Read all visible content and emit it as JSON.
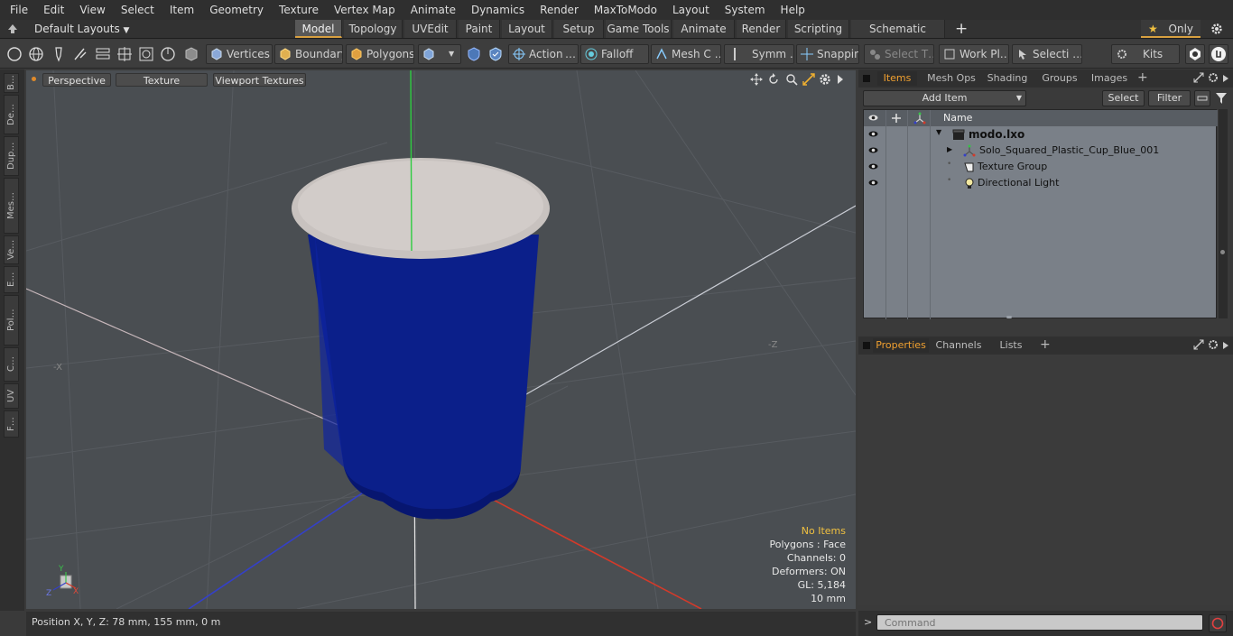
{
  "menubar": {
    "items": [
      "File",
      "Edit",
      "View",
      "Select",
      "Item",
      "Geometry",
      "Texture",
      "Vertex Map",
      "Animate",
      "Dynamics",
      "Render",
      "MaxToModo",
      "Layout",
      "System",
      "Help"
    ]
  },
  "layoutbar": {
    "layout_name": "Default Layouts",
    "tabs": [
      "Model",
      "Topology",
      "UVEdit",
      "Paint",
      "Layout",
      "Setup",
      "Game Tools",
      "Animate",
      "Render",
      "Scripting",
      "Schematic Fusion"
    ],
    "active_tab": "Model",
    "only_label": "Only"
  },
  "toolbar": {
    "vertices": "Vertices",
    "boundary": "Boundary",
    "polygons": "Polygons",
    "action": "Action",
    "action_more": "…",
    "falloff": "Falloff",
    "mesh": "Mesh C …",
    "symm": "Symm …",
    "snapping": "Snapping",
    "select_t": "Select T…",
    "work_pl": "Work Pl…",
    "selecti": "Selecti …",
    "kits": "Kits"
  },
  "leftstrip": {
    "tabs": [
      "B…",
      "De…",
      "Dup…",
      "Mes…",
      "Ve…",
      "E…",
      "Pol…",
      "C…",
      "UV",
      "F…"
    ]
  },
  "viewport": {
    "buttons": [
      "Perspective",
      "Texture",
      "Viewport Textures"
    ],
    "axis_labels": {
      "neg_x": "-X",
      "neg_z": "-Z"
    },
    "info": {
      "no_items": "No Items",
      "polygons": "Polygons : Face",
      "channels": "Channels: 0",
      "deformers": "Deformers: ON",
      "gl": "GL: 5,184",
      "grid": "10 mm"
    },
    "gizmo": {
      "y": "Y",
      "z": "Z",
      "x": "X"
    }
  },
  "status": {
    "position": "Position X, Y, Z:   78 mm, 155 mm, 0 m"
  },
  "items_panel": {
    "tabs": [
      "Items",
      "Mesh Ops",
      "Shading",
      "Groups",
      "Images"
    ],
    "active_tab": "Items",
    "add_item": "Add Item",
    "select": "Select",
    "filter": "Filter",
    "name_header": "Name",
    "rows": [
      {
        "name": "modo.lxo"
      },
      {
        "name": "Solo_Squared_Plastic_Cup_Blue_001"
      },
      {
        "name": "Texture Group"
      },
      {
        "name": "Directional Light"
      }
    ]
  },
  "properties_panel": {
    "tabs": [
      "Properties",
      "Channels",
      "Lists"
    ],
    "active_tab": "Properties"
  },
  "command": {
    "placeholder": "Command"
  },
  "colors": {
    "accent": "#f0a030",
    "cup_blue": "#0b1f8a",
    "rim": "#c8c2bf"
  }
}
